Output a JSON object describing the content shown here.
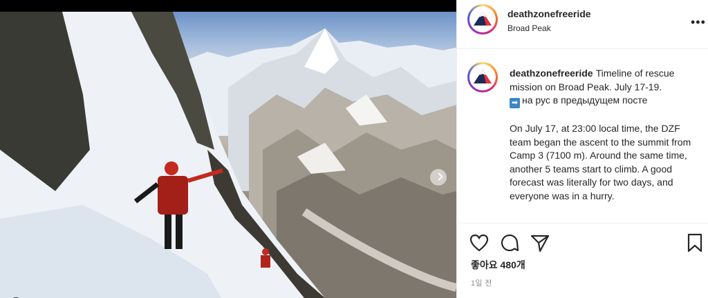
{
  "post": {
    "username": "deathzonefreeride",
    "location": "Broad Peak",
    "caption_username": "deathzonefreeride",
    "caption_line1": "Timeline of rescue mission on Broad Peak. July 17-19.",
    "caption_arrow_emoji": "➡",
    "caption_line2": "на рус в предыдущем посте",
    "caption_para2": "On July 17, at 23:00 local time, the DZF team began the ascent to the summit from Camp 3 (7100 m). Around the same time, another 5 teams start to climb. A good forecast was literally for two days, and everyone was in a hurry.",
    "likes_text": "좋아요 480개",
    "time_text": "1일 전",
    "more_glyph": "•••"
  },
  "icons": {
    "avatar": "mountain-logo-icon",
    "like": "heart-icon",
    "comment": "comment-icon",
    "share": "send-icon",
    "save": "bookmark-icon",
    "more": "more-options-icon",
    "next": "chevron-right-icon"
  },
  "colors": {
    "accent_red": "#e0303a",
    "navy": "#1e2a55",
    "text": "#262626",
    "muted": "#8e8e8e",
    "border": "#efefef"
  }
}
